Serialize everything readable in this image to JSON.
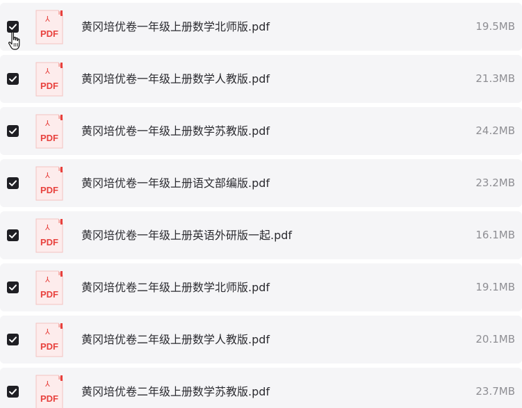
{
  "files": [
    {
      "name": "黄冈培优卷一年级上册数学北师版.pdf",
      "size": "19.5MB",
      "checked": true,
      "icon": "pdf-icon"
    },
    {
      "name": "黄冈培优卷一年级上册数学人教版.pdf",
      "size": "21.3MB",
      "checked": true,
      "icon": "pdf-icon"
    },
    {
      "name": "黄冈培优卷一年级上册数学苏教版.pdf",
      "size": "24.2MB",
      "checked": true,
      "icon": "pdf-icon"
    },
    {
      "name": "黄冈培优卷一年级上册语文部编版.pdf",
      "size": "23.2MB",
      "checked": true,
      "icon": "pdf-icon"
    },
    {
      "name": "黄冈培优卷一年级上册英语外研版一起.pdf",
      "size": "16.1MB",
      "checked": true,
      "icon": "pdf-icon"
    },
    {
      "name": "黄冈培优卷二年级上册数学北师版.pdf",
      "size": "19.1MB",
      "checked": true,
      "icon": "pdf-icon"
    },
    {
      "name": "黄冈培优卷二年级上册数学人教版.pdf",
      "size": "20.1MB",
      "checked": true,
      "icon": "pdf-icon"
    },
    {
      "name": "黄冈培优卷二年级上册数学苏教版.pdf",
      "size": "23.7MB",
      "checked": true,
      "icon": "pdf-icon"
    }
  ],
  "pdf_icon": {
    "label": "PDF",
    "color": "#e8413d",
    "symbol": "⅄"
  },
  "colors": {
    "row_background": "#f5f5f7",
    "checkbox": "#1f1f24",
    "text": "#2b2b30",
    "size_text": "#8e8e93",
    "accent": "#e8413d"
  },
  "cursor": "hand-pointer-icon"
}
